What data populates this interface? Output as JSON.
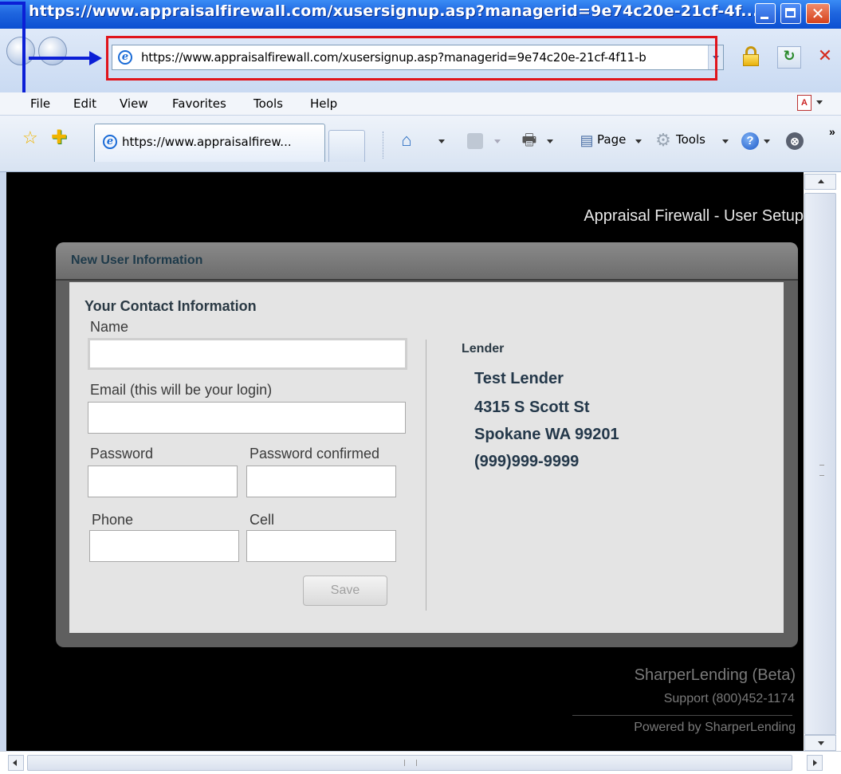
{
  "window": {
    "title": "https://www.appraisalfirewall.com/xusersignup.asp?managerid=9e74c20e-21cf-4f...",
    "close_glyph": "✕"
  },
  "address_bar": {
    "url": "https://www.appraisalfirewall.com/xusersignup.asp?managerid=9e74c20e-21cf-4f11-b"
  },
  "menu": {
    "file": "File",
    "edit": "Edit",
    "view": "View",
    "favorites": "Favorites",
    "tools": "Tools",
    "help": "Help"
  },
  "tabs": [
    {
      "label": "https://www.appraisalfirew..."
    }
  ],
  "command_bar": {
    "page_label": "Page",
    "tools_label": "Tools",
    "more": "»"
  },
  "page": {
    "heading": "Appraisal Firewall - User Setup",
    "panel_title": "New User Information",
    "section_title": "Your Contact Information",
    "fields": {
      "name_label": "Name",
      "name_value": "",
      "email_label": "Email (this will be your login)",
      "email_value": "",
      "password_label": "Password",
      "password_value": "",
      "password_confirm_label": "Password confirmed",
      "password_confirm_value": "",
      "phone_label": "Phone",
      "phone_value": "",
      "cell_label": "Cell",
      "cell_value": ""
    },
    "save_label": "Save",
    "lender": {
      "label": "Lender",
      "name": "Test Lender",
      "street": "4315 S Scott St",
      "city_state_zip": "Spokane WA 99201",
      "phone": "(999)999-9999"
    },
    "footer": {
      "brand": "SharperLending (Beta)",
      "support": "Support  (800)452-1174",
      "powered": "Powered by SharperLending"
    }
  },
  "icons": {
    "ie": "e",
    "home": "⌂",
    "print": "🖶",
    "page": "▤",
    "tools": "⚙",
    "help": "?",
    "block": "⊗",
    "favorites_star": "☆",
    "add_favorite": "✚",
    "refresh": "↻",
    "stop": "✕",
    "pdf": "A"
  },
  "colors": {
    "titlebar": "#1f66df",
    "annotation": "#0b1fd6",
    "address_highlight": "#e0141b",
    "page_background": "#000000",
    "panel": "#5f5f5f",
    "form": "#e4e4e4",
    "lender_text": "#24384a"
  }
}
